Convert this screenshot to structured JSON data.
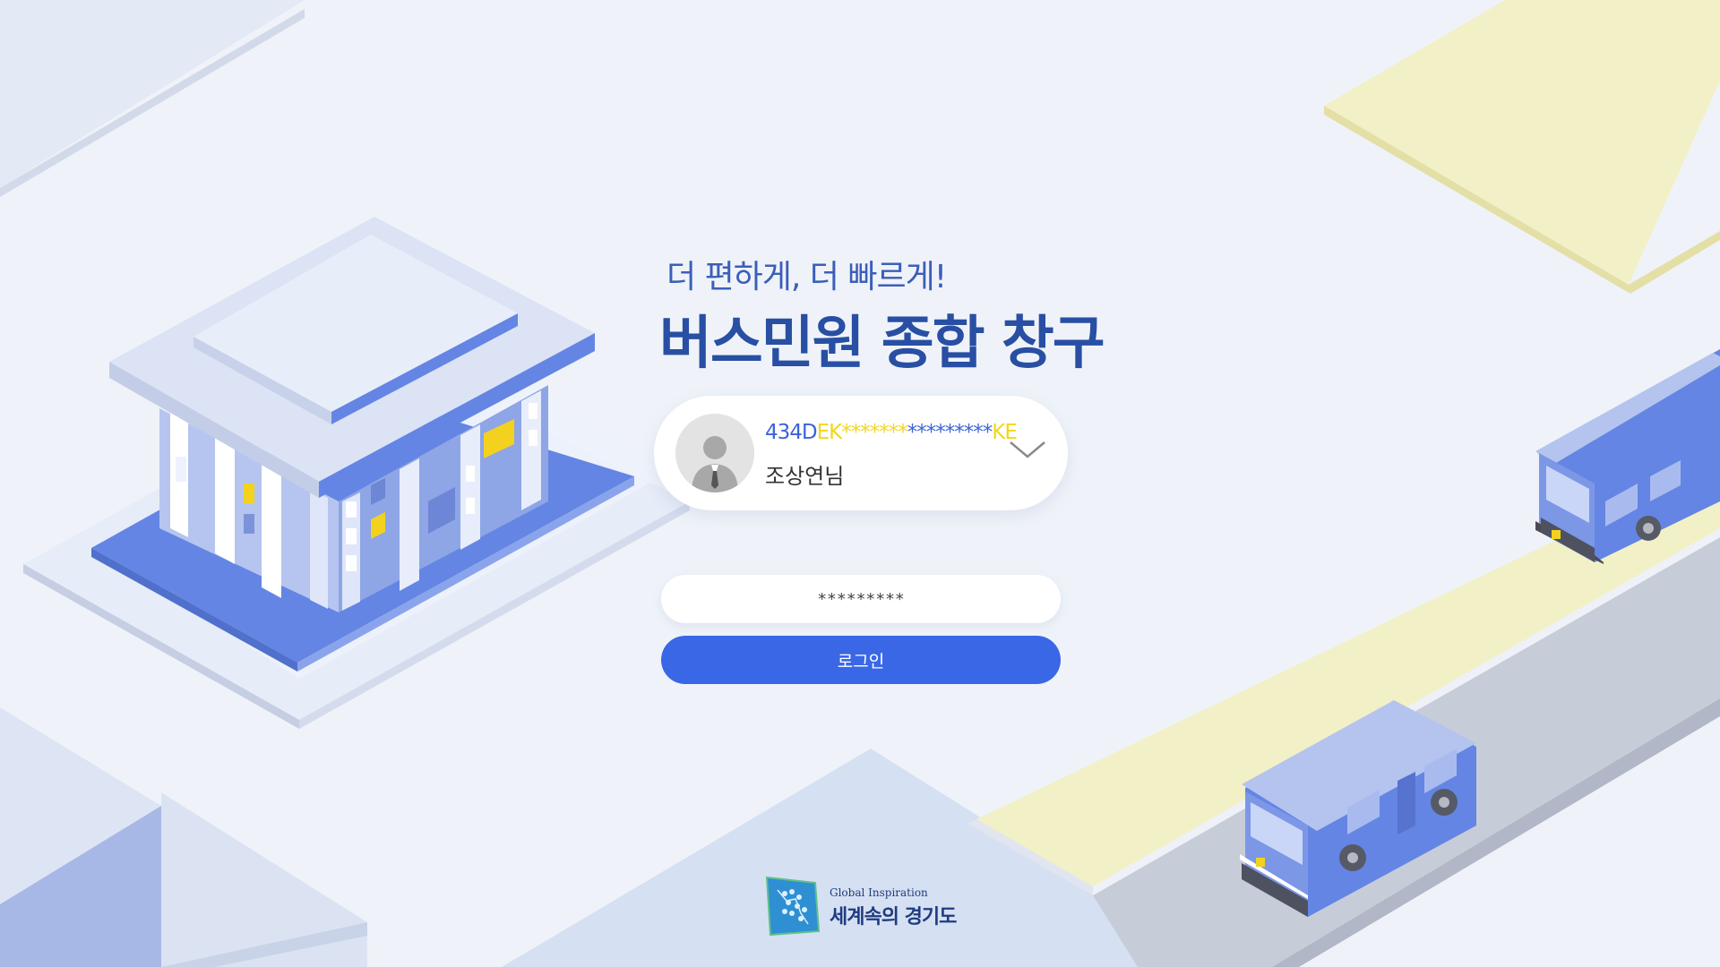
{
  "header": {
    "subtitle": "더 편하게, 더 빠르게!",
    "title": "버스민원 종합 창구"
  },
  "account": {
    "id_parts": [
      {
        "text": "434D",
        "color": "#3d63d9"
      },
      {
        "text": "EK",
        "color": "#f1d71c"
      },
      {
        "text": "*******",
        "color": "#f1d71c"
      },
      {
        "text": "*********",
        "color": "#3d63d9"
      },
      {
        "text": "KE",
        "color": "#f1d71c"
      }
    ],
    "name": "조상연님",
    "avatar_icon": "user-avatar-icon",
    "dropdown_icon": "chevron-down-icon"
  },
  "password": {
    "value": "*********"
  },
  "login": {
    "label": "로그인"
  },
  "logo": {
    "english": "Global Inspiration",
    "korean": "세계속의 경기도"
  },
  "colors": {
    "background": "#eff3f9",
    "title": "#284fa3",
    "subtitle": "#3b5fb8",
    "accent": "#3a67e6",
    "road_yellow": "#f2f0c6",
    "building_blue": "#6485e3"
  }
}
